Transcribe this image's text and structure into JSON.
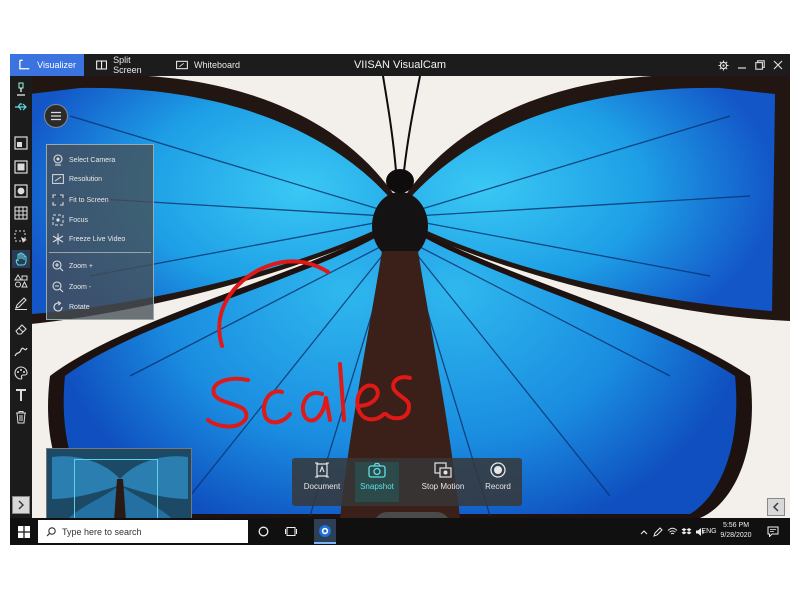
{
  "app": {
    "title": "VIISAN VisualCam",
    "tabs": [
      {
        "label": "Visualizer",
        "active": true,
        "icon": "visualizer-icon"
      },
      {
        "label": "Split Screen",
        "active": false,
        "icon": "split-screen-icon"
      },
      {
        "label": "Whiteboard",
        "active": false,
        "icon": "whiteboard-icon"
      }
    ],
    "window_controls": [
      "gear-icon",
      "minimize-icon",
      "restore-icon",
      "close-icon"
    ],
    "accent_color": "#3b73e0"
  },
  "left_toolbar": {
    "tools": [
      "usb-icon",
      "camera-source-icon",
      "window-icon",
      "stack-icon",
      "grid-icon",
      "select-icon",
      "hand-icon",
      "shapes-icon",
      "pen-icon",
      "eraser-icon",
      "brush-icon",
      "palette-icon",
      "text-icon",
      "trash-icon"
    ]
  },
  "camera_menu": {
    "items": [
      {
        "label": "Select Camera",
        "icon": "webcam-icon"
      },
      {
        "label": "Resolution",
        "icon": "resolution-icon"
      },
      {
        "label": "Fit to Screen",
        "icon": "fit-screen-icon"
      },
      {
        "label": "Focus",
        "icon": "focus-icon"
      },
      {
        "label": "Freeze Live Video",
        "icon": "freeze-icon"
      },
      {
        "label": "Zoom +",
        "icon": "zoom-in-icon"
      },
      {
        "label": "Zoom -",
        "icon": "zoom-out-icon"
      },
      {
        "label": "Rotate",
        "icon": "rotate-icon"
      }
    ]
  },
  "annotation": {
    "text": "scales",
    "color": "#e01818"
  },
  "capture_bar": {
    "buttons": [
      {
        "label": "Document",
        "icon": "document-icon",
        "selected": false
      },
      {
        "label": "Snapshot",
        "icon": "camera-icon",
        "selected": true
      },
      {
        "label": "Stop Motion",
        "icon": "stop-motion-icon",
        "selected": false
      },
      {
        "label": "Record",
        "icon": "record-icon",
        "selected": false
      }
    ],
    "highlight_color": "#5fe0e8"
  },
  "taskbar": {
    "search_placeholder": "Type here to search",
    "language": "ENG",
    "time": "5:56 PM",
    "date": "9/28/2020"
  }
}
